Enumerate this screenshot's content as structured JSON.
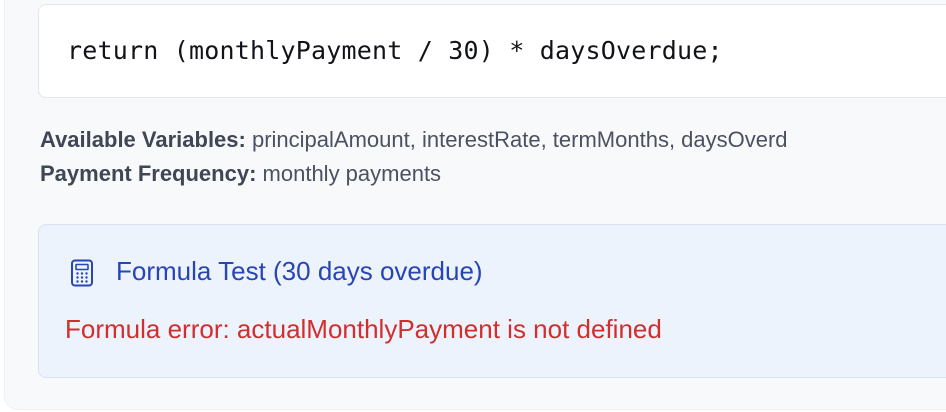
{
  "formula": {
    "code": "return (monthlyPayment / 30) * daysOverdue;"
  },
  "info": {
    "variables_label": "Available Variables:",
    "variables_value": "principalAmount, interestRate, termMonths, daysOverd",
    "frequency_label": "Payment Frequency:",
    "frequency_value": "monthly payments"
  },
  "test": {
    "icon": "calculator-icon",
    "title": "Formula Test (30 days overdue)",
    "error": "Formula error: actualMonthlyPayment is not defined"
  },
  "colors": {
    "title_blue": "#2745b4",
    "error_red": "#d12e2e",
    "test_bg": "#edf3fc"
  }
}
